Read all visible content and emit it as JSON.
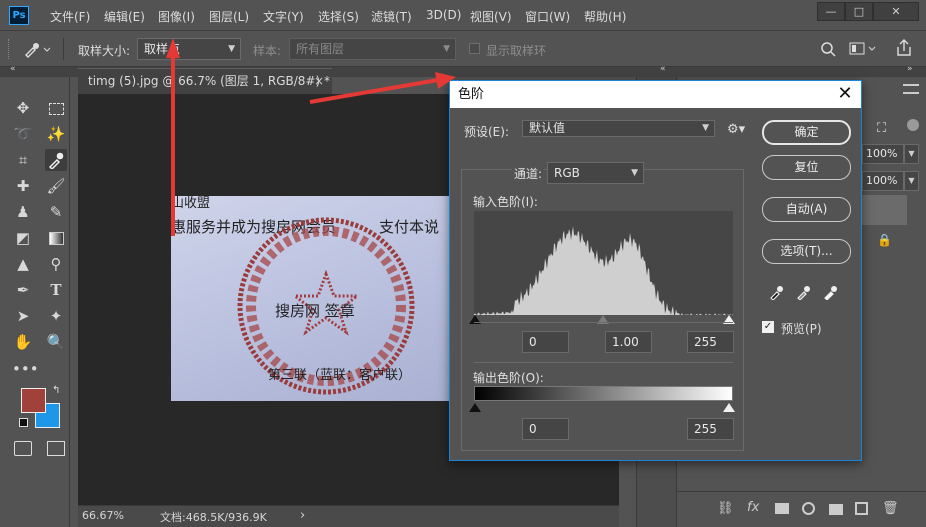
{
  "app": {
    "logo": "Ps"
  },
  "menu": [
    "文件(F)",
    "编辑(E)",
    "图像(I)",
    "图层(L)",
    "文字(Y)",
    "选择(S)",
    "滤镜(T)",
    "3D(D)",
    "视图(V)",
    "窗口(W)",
    "帮助(H)"
  ],
  "window_controls": {
    "minimize": "—",
    "restore": "□",
    "close": "✕"
  },
  "options_bar": {
    "sample_size_label": "取样大小:",
    "sample_size_value": "取样点",
    "sample_label": "样本:",
    "sample_value": "所有图层",
    "show_ring_label": "显示取样环"
  },
  "document": {
    "tab_title": "timg (5).jpg @ 66.7% (图层 1, RGB/8#) *",
    "tab_close": "×",
    "image_text": {
      "line_top": "山收盟",
      "line_service": "惠服务并成为搜房网会员",
      "line_pay": "支付本说",
      "stamp_center": "搜房网 签章",
      "line_bottom": "第三联（蓝联：客户联）"
    }
  },
  "status": {
    "zoom": "66.67%",
    "doc": "文档:468.5K/936.9K",
    "arrow": "›"
  },
  "dialog": {
    "title": "色阶",
    "close": "✕",
    "preset_label": "预设(E):",
    "preset_value": "默认值",
    "channel_label": "通道:",
    "channel_value": "RGB",
    "input_levels_label": "输入色阶(I):",
    "input_black": "0",
    "input_gamma": "1.00",
    "input_white": "255",
    "output_levels_label": "输出色阶(O):",
    "output_black": "0",
    "output_white": "255",
    "buttons": {
      "ok": "确定",
      "reset": "复位",
      "auto": "自动(A)",
      "options": "选项(T)..."
    },
    "preview_label": "预览(P)",
    "preview_checked": true
  },
  "layers_panel": {
    "opacity": "100%",
    "fill": "100%"
  },
  "colors": {
    "foreground": "#a0413a",
    "background": "#1e97e8",
    "accent": "#1c84d8",
    "arrow": "#e53935"
  }
}
